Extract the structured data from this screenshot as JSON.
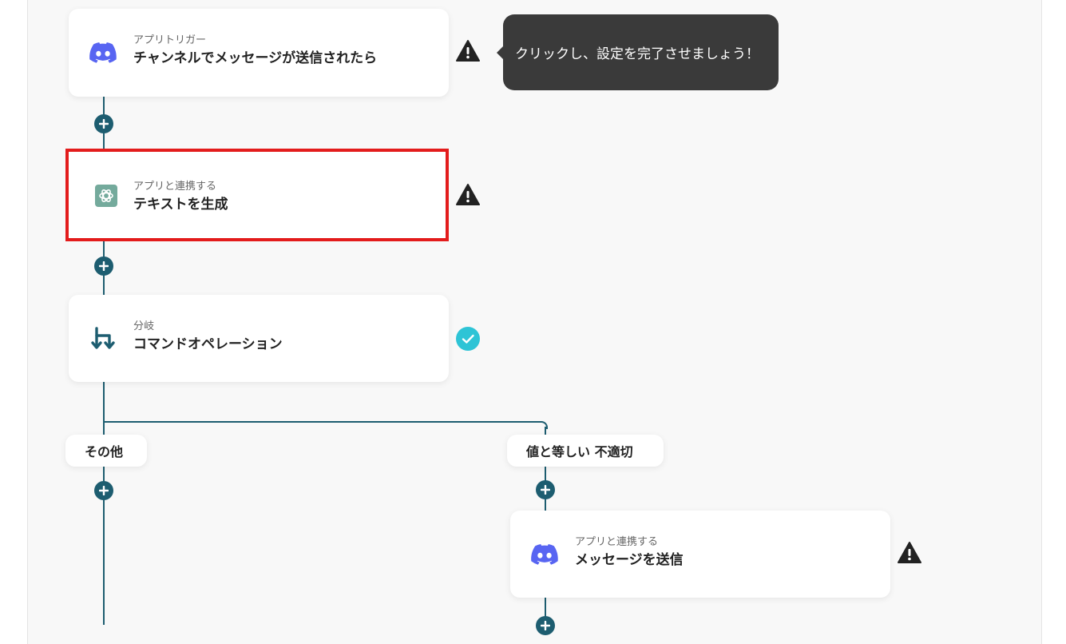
{
  "tooltip": {
    "text": "クリックし、設定を完了させましょう！"
  },
  "cards": [
    {
      "sub": "アプリトリガー",
      "title": "チャンネルでメッセージが送信されたら",
      "icon": "discord-icon",
      "status": "warning"
    },
    {
      "sub": "アプリと連携する",
      "title": "テキストを生成",
      "icon": "chatgpt-icon",
      "status": "warning"
    },
    {
      "sub": "分岐",
      "title": "コマンドオペレーション",
      "icon": "branch-icon",
      "status": "complete"
    },
    {
      "sub": "アプリと連携する",
      "title": "メッセージを送信",
      "icon": "discord-icon",
      "status": "warning"
    }
  ],
  "branches": {
    "left_label": "その他",
    "right_label": "値と等しい 不適切"
  },
  "colors": {
    "line": "#1d5d70",
    "highlight": "#e31c1c",
    "discord": "#5865F2",
    "chatgpt": "#74aa9c",
    "check": "#2ec4d6",
    "tooltip_bg": "#3a3a3a"
  }
}
